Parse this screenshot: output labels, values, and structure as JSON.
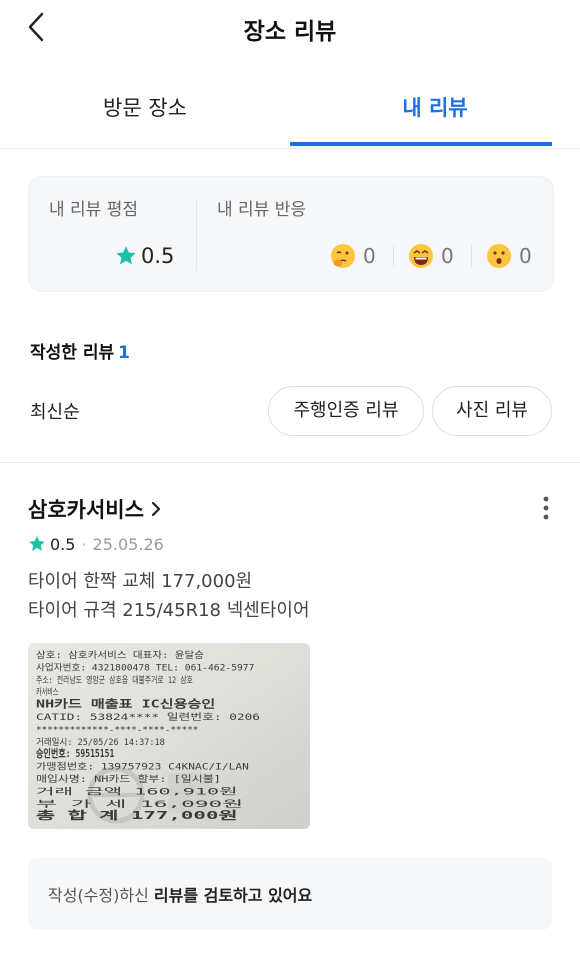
{
  "header": {
    "title": "장소 리뷰",
    "back_icon": "chevron-left-icon"
  },
  "tabs": [
    {
      "label": "방문 장소",
      "active": false
    },
    {
      "label": "내 리뷰",
      "active": true
    }
  ],
  "colors": {
    "accent": "#1f6fe5",
    "star": "#19c0a8"
  },
  "summary": {
    "rating_label": "내 리뷰 평점",
    "rating_value": "0.5",
    "reactions_label": "내 리뷰 반응",
    "reactions": [
      {
        "icon": "hmm-emoji-icon",
        "count": "0"
      },
      {
        "icon": "laugh-emoji-icon",
        "count": "0"
      },
      {
        "icon": "surprised-emoji-icon",
        "count": "0"
      }
    ]
  },
  "list": {
    "written_label": "작성한 리뷰",
    "written_count": "1",
    "sort_label": "최신순",
    "filters": [
      "주행인증 리뷰",
      "사진 리뷰"
    ]
  },
  "review": {
    "place": "삼호카서비스",
    "rating": "0.5",
    "date": "25.05.26",
    "lines": [
      "타이어 한짝 교체 177,000원",
      "타이어 규격 215/45R18 넥센타이어"
    ],
    "status_prefix": "작성(수정)하신 ",
    "status_bold": "리뷰를 검토하고 있어요"
  },
  "receipt": {
    "lines": [
      "상호: 삼호카서비스            대표자: 윤달승",
      "사업자번호: 4321800478     TEL: 061-462-5977",
      "주소: 전라남도 영암군 삼호읍 대불주거로 12 삼호",
      "카서비스",
      "NH카드 매출표                  IC신용승인",
      "CATID: 53824****              일련번호: 0206",
      "*************-****-****-*****",
      "거래일시: 25/05/26 14:37:18",
      "승인번호: 59515151",
      "가맹점번호: 139757923          C4KNAC/I/LAN",
      "매입사명: NH카드              할부: [일시불]",
      "거래 금액                       160,910원",
      "부 가 세                         16,090원",
      "총 합 계                       177,000원"
    ]
  }
}
